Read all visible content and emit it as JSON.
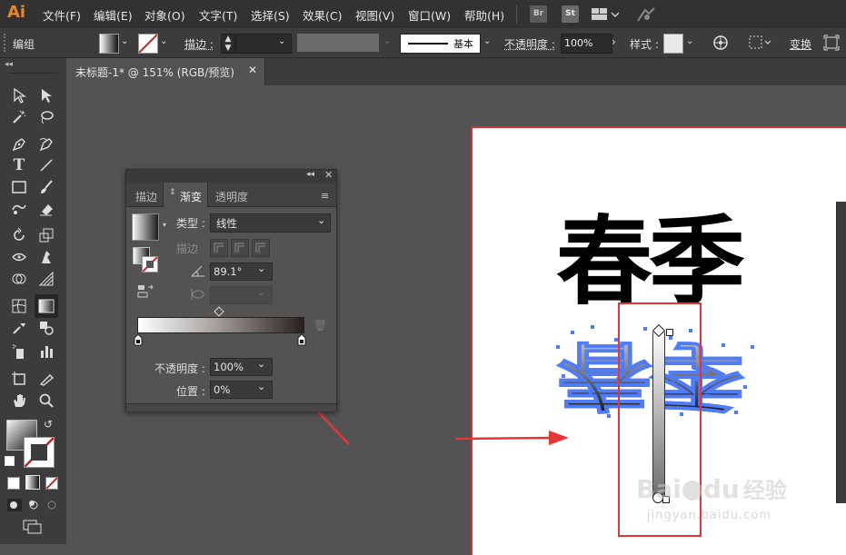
{
  "app": {
    "logo": "Ai"
  },
  "menu": {
    "items": [
      "文件(F)",
      "编辑(E)",
      "对象(O)",
      "文字(T)",
      "选择(S)",
      "效果(C)",
      "视图(V)",
      "窗口(W)",
      "帮助(H)"
    ],
    "bridge_label": "Br",
    "stock_label": "St"
  },
  "control": {
    "selection_type": "编组",
    "stroke_label": "描边 :",
    "stroke_style": "基本",
    "opacity_label": "不透明度 :",
    "opacity_value": "100%",
    "style_label": "样式 :",
    "transform_label": "变换"
  },
  "document": {
    "tab_title": "未标题-1* @ 151% (RGB/预览)"
  },
  "gradient_panel": {
    "tabs": [
      "描边",
      "渐变",
      "透明度"
    ],
    "type_label": "类型 :",
    "type_value": "线性",
    "stroke_label": "描边",
    "angle_value": "89.1°",
    "opacity_label": "不透明度 :",
    "opacity_value": "100%",
    "location_label": "位置 :",
    "location_value": "0%"
  },
  "canvas": {
    "headline": "春季",
    "reflection": "春季"
  },
  "watermark": {
    "brand": "Bai",
    "brand2": "du",
    "suffix": "经验",
    "url": "jingyan.baidu.com"
  },
  "colors": {
    "annotation_red": "#e53535",
    "menubar": "#323232",
    "panel": "#535353",
    "selection_blue": "#4d7cff"
  }
}
